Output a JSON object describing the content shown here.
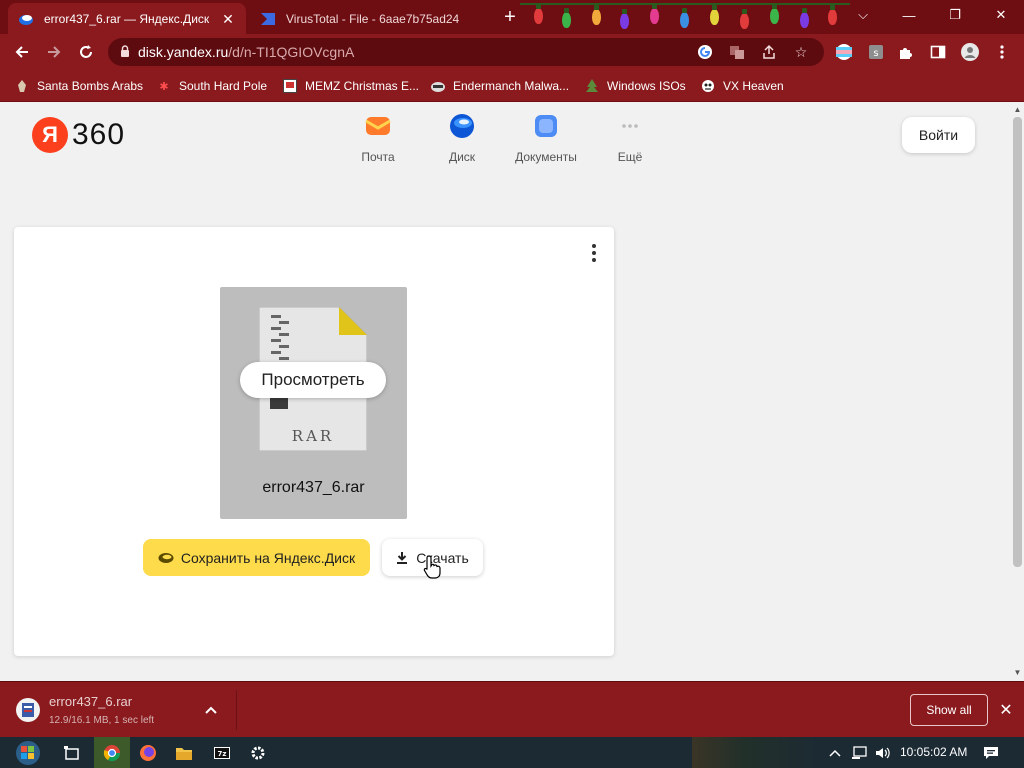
{
  "browser": {
    "tabs": [
      {
        "title": "error437_6.rar — Яндекс.Диск",
        "active": true
      },
      {
        "title": "VirusTotal - File - 6aae7b75ad24",
        "active": false
      }
    ],
    "url_host": "disk.yandex.ru",
    "url_path": "/d/n-TI1QGIOVcgnA",
    "bookmarks": [
      {
        "label": "Santa Bombs Arabs",
        "icon": "santa-icon"
      },
      {
        "label": "South Hard Pole",
        "icon": "snowflake-icon"
      },
      {
        "label": "MEMZ Christmas E...",
        "icon": "memz-icon"
      },
      {
        "label": "Endermanch Malwa...",
        "icon": "raccoon-icon"
      },
      {
        "label": "Windows ISOs",
        "icon": "tree-icon"
      },
      {
        "label": "VX Heaven",
        "icon": "vx-icon"
      }
    ]
  },
  "header": {
    "logo_letter": "Я",
    "logo_text": "360",
    "services": [
      {
        "label": "Почта",
        "icon": "mail-icon",
        "color": "#ff6a2b"
      },
      {
        "label": "Диск",
        "icon": "disk-icon",
        "color": "#1e6fe6"
      },
      {
        "label": "Документы",
        "icon": "documents-icon",
        "color": "#4d8cf5"
      },
      {
        "label": "Ещё",
        "icon": "more-icon",
        "color": "#bbbbbb"
      }
    ],
    "login_label": "Войти"
  },
  "file": {
    "name": "error437_6.rar",
    "type_label": "RAR",
    "view_label": "Просмотреть",
    "save_label": "Сохранить на Яндекс.Диск",
    "download_label": "Скачать"
  },
  "download_shelf": {
    "file_name": "error437_6.rar",
    "status": "12.9/16.1 MB, 1 sec left",
    "show_all_label": "Show all"
  },
  "taskbar": {
    "clock": "10:05:02 AM"
  },
  "colors": {
    "chrome_frame": "#8a1a1e",
    "yandex_red": "#fc3f1d",
    "save_button_yellow": "#fedb4a"
  }
}
